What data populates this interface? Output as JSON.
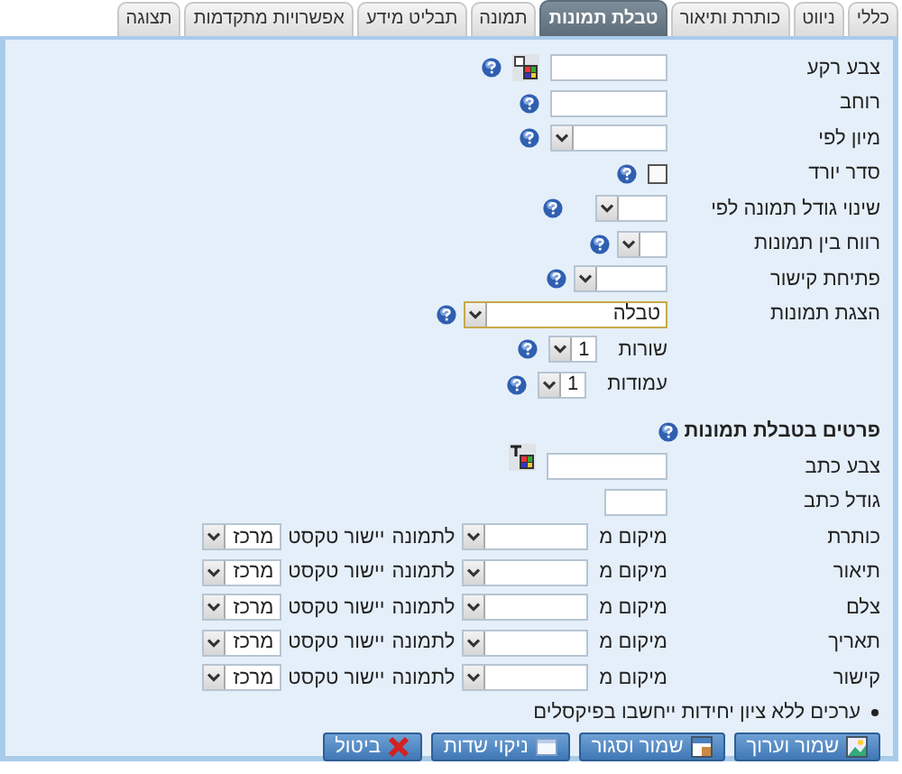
{
  "tabs": [
    {
      "label": "כללי",
      "selected": false
    },
    {
      "label": "ניווט",
      "selected": false
    },
    {
      "label": "כותרת ותיאור",
      "selected": false
    },
    {
      "label": "טבלת תמונות",
      "selected": true
    },
    {
      "label": "תמונה",
      "selected": false
    },
    {
      "label": "תבליט מידע",
      "selected": false
    },
    {
      "label": "אפשרויות מתקדמות",
      "selected": false
    },
    {
      "label": "תצוגה",
      "selected": false
    }
  ],
  "settings": [
    {
      "kind": "bgcolor",
      "label": "צבע רקע",
      "help": true
    },
    {
      "kind": "text",
      "label": "רוחב",
      "help": true
    },
    {
      "kind": "select",
      "label": "מיון לפי",
      "help": true
    },
    {
      "kind": "checkbox",
      "label": "סדר יורד",
      "checked": false,
      "help": true
    },
    {
      "kind": "select",
      "label": "שינוי גודל תמונה לפי",
      "help": true
    },
    {
      "kind": "select",
      "label": "רווח בין תמונות",
      "help": true
    },
    {
      "kind": "select",
      "label": "פתיחת קישור",
      "help": true
    },
    {
      "kind": "select",
      "label": "הצגת תמונות",
      "value": "טבלה",
      "focused": true,
      "help": true
    },
    {
      "kind": "inline-select",
      "label": "שורות",
      "value": "1",
      "help": true
    },
    {
      "kind": "inline-select",
      "label": "עמודות",
      "value": "1",
      "help": true
    }
  ],
  "details": {
    "title": "פרטים בטבלת תמונות",
    "help": true,
    "fields": [
      {
        "kind": "fontcolor",
        "label": "צבע כתב"
      },
      {
        "kind": "text",
        "label": "גודל כתב"
      }
    ],
    "items": [
      {
        "label": "כותרת",
        "position_label": "מיקום מ",
        "relative_label": "לתמונה",
        "align_label": "יישור טקסט",
        "align": "מרכז"
      },
      {
        "label": "תיאור",
        "position_label": "מיקום מ",
        "relative_label": "לתמונה",
        "align_label": "יישור טקסט",
        "align": "מרכז"
      },
      {
        "label": "צלם",
        "position_label": "מיקום מ",
        "relative_label": "לתמונה",
        "align_label": "יישור טקסט",
        "align": "מרכז"
      },
      {
        "label": "תאריך",
        "position_label": "מיקום מ",
        "relative_label": "לתמונה",
        "align_label": "יישור טקסט",
        "align": "מרכז"
      },
      {
        "label": "קישור",
        "position_label": "מיקום מ",
        "relative_label": "לתמונה",
        "align_label": "יישור טקסט",
        "align": "מרכז"
      }
    ]
  },
  "note": "ערכים ללא ציון יחידות ייחשבו בפיקסלים",
  "buttons": [
    {
      "kind": "save-edit",
      "label": "שמור וערוך"
    },
    {
      "kind": "save-close",
      "label": "שמור וסגור"
    },
    {
      "kind": "clear",
      "label": "ניקוי שדות"
    },
    {
      "kind": "cancel",
      "label": "ביטול"
    }
  ]
}
